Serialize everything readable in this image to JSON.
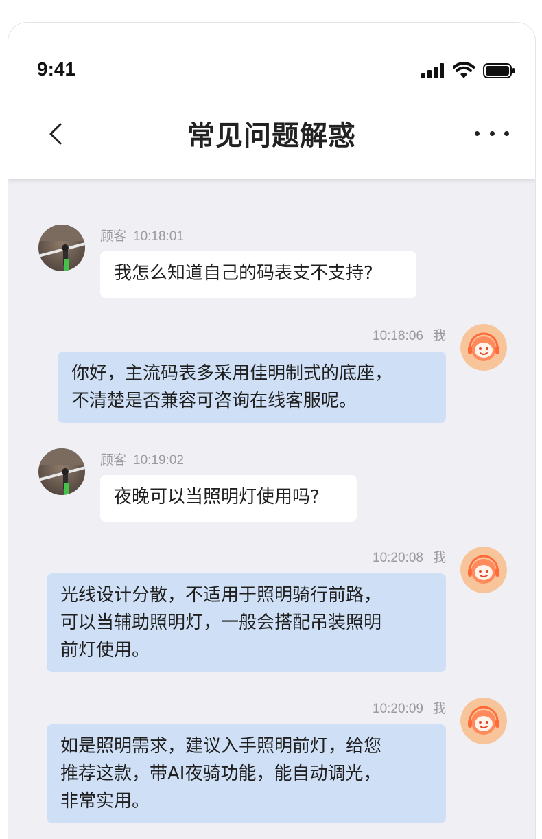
{
  "status_bar": {
    "time": "9:41"
  },
  "header": {
    "title": "常见问题解惑"
  },
  "messages": [
    {
      "sender": "顾客",
      "time": "10:18:01",
      "text": "我怎么知道自己的码表支不支持?"
    },
    {
      "sender": "我",
      "time": "10:18:06",
      "text": "你好，主流码表多采用佳明制式的底座，\n不清楚是否兼容可咨询在线客服呢。"
    },
    {
      "sender": "顾客",
      "time": "10:19:02",
      "text": "夜晚可以当照明灯使用吗?"
    },
    {
      "sender": "我",
      "time": "10:20:08",
      "text": "光线设计分散，不适用于照明骑行前路，\n可以当辅助照明灯，一般会搭配吊装照明\n前灯使用。"
    },
    {
      "sender": "我",
      "time": "10:20:09",
      "text": "如是照明需求，建议入手照明前灯，给您\n推荐这款，带AI夜骑功能，能自动调光，\n非常实用。"
    }
  ],
  "colors": {
    "bot_bubble": "#cfe0f6",
    "user_bubble": "#ffffff",
    "chat_bg": "#efeff4",
    "bot_avatar": "#f5a66a"
  }
}
